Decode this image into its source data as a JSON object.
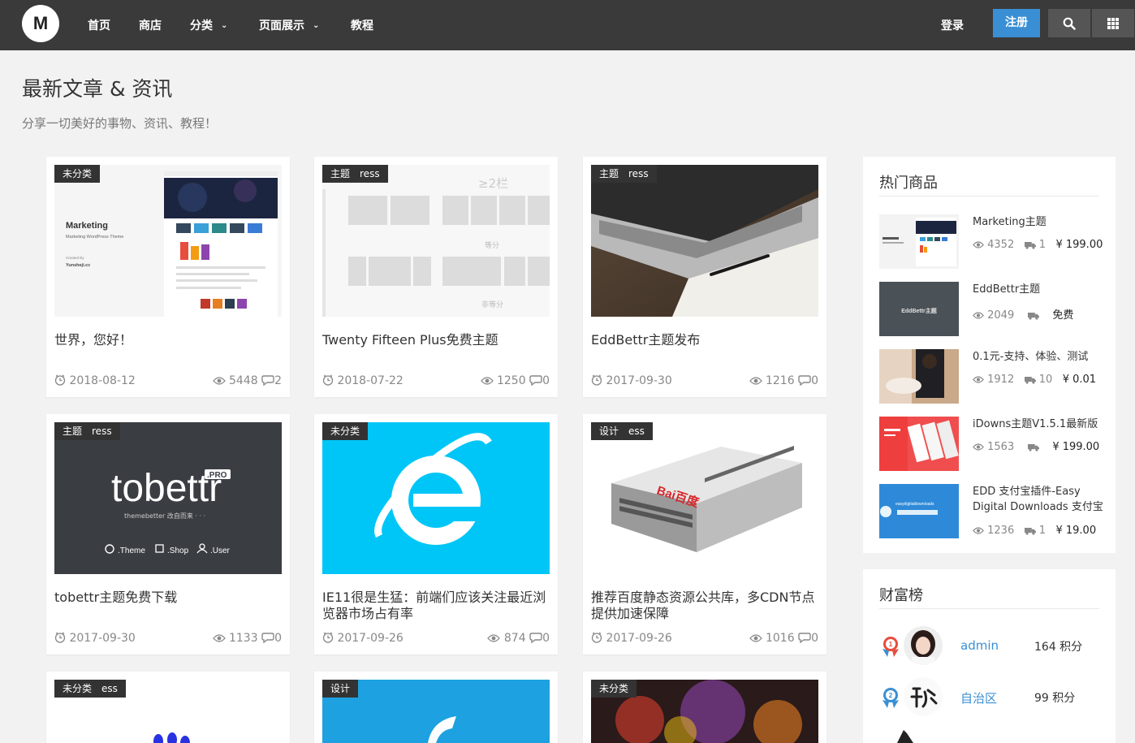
{
  "header": {
    "logo": "M",
    "nav": [
      {
        "label": "首页",
        "dropdown": false
      },
      {
        "label": "商店",
        "dropdown": false
      },
      {
        "label": "分类",
        "dropdown": true
      },
      {
        "label": "页面展示",
        "dropdown": true
      },
      {
        "label": "教程",
        "dropdown": false
      }
    ],
    "login": "登录",
    "register": "注册",
    "search_icon": "search-icon",
    "grid_icon": "grid-icon"
  },
  "page": {
    "title": "最新文章 & 资讯",
    "subtitle": "分享一切美好的事物、资讯、教程！"
  },
  "posts": [
    {
      "tag": "未分类",
      "tag2": "",
      "title": "世界，您好！",
      "date": "2018-08-12",
      "views": "5448",
      "comments": "2",
      "thumb": "marketing-theme-screenshot",
      "thumb_text": {
        "heading": "Marketing",
        "sub": "Marketing WordPress Theme",
        "credit1": "Created By",
        "credit2": "Yunsheji.cc"
      }
    },
    {
      "tag": "主题",
      "tag2": "ress",
      "title": "Twenty Fifteen Plus免费主题",
      "date": "2018-07-22",
      "views": "1250",
      "comments": "0",
      "thumb": "layout-grid-wireframe",
      "thumb_text": {
        "a": "≥2栏",
        "b": "等分",
        "c": "非等分"
      }
    },
    {
      "tag": "主题",
      "tag2": "ress",
      "title": "EddBettr主题发布",
      "date": "2017-09-30",
      "views": "1216",
      "comments": "0",
      "thumb": "laptop-notebook-photo"
    },
    {
      "tag": "主题",
      "tag2": "ress",
      "title": "tobettr主题免费下载",
      "date": "2017-09-30",
      "views": "1133",
      "comments": "0",
      "thumb": "tobettr-logo",
      "thumb_text": {
        "logo": "tobettr",
        "pro": ".PRO",
        "slogan": "themebetter 改自而来 · · ·",
        "l1": ".Theme",
        "l2": ".Shop",
        "l3": ".User"
      }
    },
    {
      "tag": "未分类",
      "tag2": "",
      "title": "IE11很是生猛：前端们应该关注最近浏览器市场占有率",
      "date": "2017-09-26",
      "views": "874",
      "comments": "0",
      "thumb": "ie-logo"
    },
    {
      "tag": "设计",
      "tag2": "ess",
      "title": "推荐百度静态资源公共库，多CDN节点提供加速保障",
      "date": "2017-09-26",
      "views": "1016",
      "comments": "0",
      "thumb": "baidu-server-photo",
      "thumb_text": {
        "brand": "Bai百度"
      }
    },
    {
      "tag": "未分类",
      "tag2": "ess",
      "title": "",
      "date": "",
      "views": "",
      "comments": "",
      "thumb": "paw-icon"
    },
    {
      "tag": "设计",
      "tag2": "",
      "title": "",
      "date": "",
      "views": "",
      "comments": "",
      "thumb": "blue-logo"
    },
    {
      "tag": "未分类",
      "tag2": "",
      "title": "",
      "date": "",
      "views": "",
      "comments": "",
      "thumb": "colorful-photo"
    }
  ],
  "hot_products": {
    "title": "热门商品",
    "items": [
      {
        "name": "Marketing主题",
        "views": "4352",
        "sales": "1",
        "price": "¥ 199.00"
      },
      {
        "name": "EddBettr主题",
        "views": "2049",
        "sales": "",
        "price": "免费",
        "img_text": "EddBettr主题"
      },
      {
        "name": "0.1元-支持、体验、测试",
        "views": "1912",
        "sales": "10",
        "price": "¥ 0.01"
      },
      {
        "name": "iDowns主题V1.5.1最新版",
        "views": "1563",
        "sales": "",
        "price": "¥ 199.00"
      },
      {
        "name": "EDD 支付宝插件-Easy Digital Downloads 支付宝",
        "views": "1236",
        "sales": "1",
        "price": "¥ 19.00",
        "img_text": "easydigitaldownloads"
      }
    ]
  },
  "wealth": {
    "title": "财富榜",
    "items": [
      {
        "rank": "1",
        "name": "admin",
        "points": "164 积分"
      },
      {
        "rank": "2",
        "name": "自治区",
        "points": "99 积分"
      }
    ]
  }
}
